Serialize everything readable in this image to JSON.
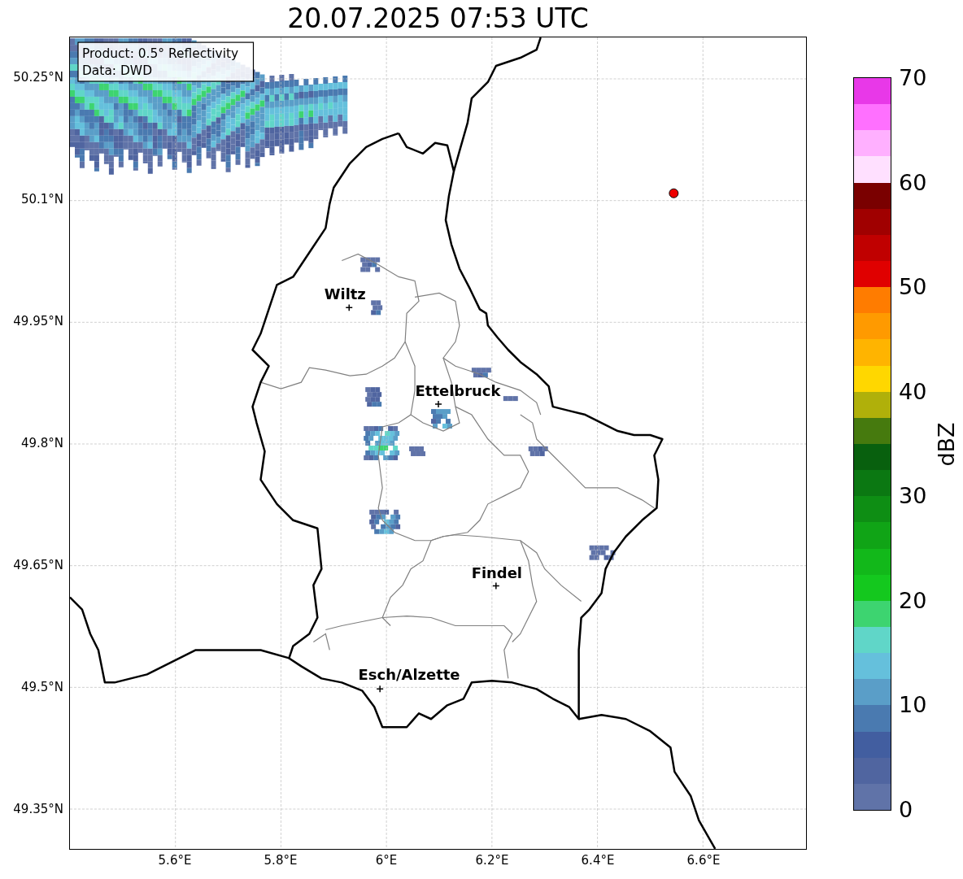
{
  "title": "20.07.2025 07:53 UTC",
  "map": {
    "info_box": [
      "Product: 0.5° Reflectivity",
      "Data: DWD"
    ],
    "lat_ticks": [
      "50.25°N",
      "50.1°N",
      "49.95°N",
      "49.8°N",
      "49.65°N",
      "49.5°N",
      "49.35°N"
    ],
    "lon_ticks": [
      "5.6°E",
      "5.8°E",
      "6°E",
      "6.2°E",
      "6.4°E",
      "6.6°E"
    ],
    "cities": [
      {
        "name": "Wiltz"
      },
      {
        "name": "Ettelbruck"
      },
      {
        "name": "Findel"
      },
      {
        "name": "Esch/Alzette"
      }
    ]
  },
  "colorbar": {
    "label": "dBZ",
    "ticks": [
      "70",
      "60",
      "50",
      "40",
      "30",
      "20",
      "10",
      "0"
    ],
    "segments": [
      {
        "color": "#6073a8"
      },
      {
        "color": "#5065a0"
      },
      {
        "color": "#425ea0"
      },
      {
        "color": "#4a7ab0"
      },
      {
        "color": "#5a9ec8"
      },
      {
        "color": "#65c0dc"
      },
      {
        "color": "#60d6c8"
      },
      {
        "color": "#3dd470"
      },
      {
        "color": "#14c81e"
      },
      {
        "color": "#12b81a"
      },
      {
        "color": "#10a416"
      },
      {
        "color": "#0e8e14"
      },
      {
        "color": "#0b7812"
      },
      {
        "color": "#08600e"
      },
      {
        "color": "#467a0e"
      },
      {
        "color": "#b0b00a"
      },
      {
        "color": "#ffd700"
      },
      {
        "color": "#ffb400"
      },
      {
        "color": "#ff9a00"
      },
      {
        "color": "#ff7c00"
      },
      {
        "color": "#e00000"
      },
      {
        "color": "#c00000"
      },
      {
        "color": "#a00000"
      },
      {
        "color": "#7a0000"
      },
      {
        "color": "#ffe0ff"
      },
      {
        "color": "#ffb0ff"
      },
      {
        "color": "#ff70ff"
      },
      {
        "color": "#e838e8"
      }
    ]
  }
}
